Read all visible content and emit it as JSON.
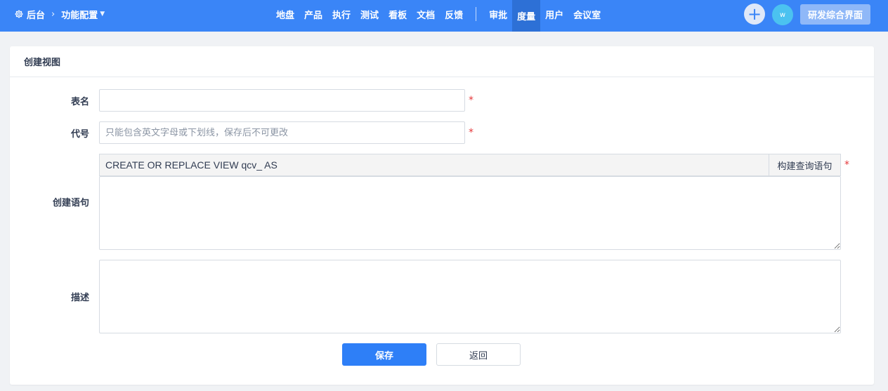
{
  "header": {
    "breadcrumb_root": "后台",
    "breadcrumb_separator": "›",
    "breadcrumb_current": "功能配置",
    "nav": [
      "地盘",
      "产品",
      "执行",
      "测试",
      "看板",
      "文档",
      "反馈"
    ],
    "nav_right": [
      "审批",
      "度量",
      "用户",
      "会议室"
    ],
    "active_nav": "度量",
    "plus_label": "+",
    "avatar_text": "w",
    "workspace_button": "研发综合界面"
  },
  "panel": {
    "title": "创建视图"
  },
  "form": {
    "table_name_label": "表名",
    "table_name_value": "",
    "code_label": "代号",
    "code_placeholder": "只能包含英文字母或下划线，保存后不可更改",
    "sql_label": "创建语句",
    "sql_prefix": "CREATE OR REPLACE VIEW qcv_ AS",
    "build_query_button": "构建查询语句",
    "description_label": "描述",
    "required_mark": "*"
  },
  "actions": {
    "save": "保存",
    "back": "返回"
  },
  "colors": {
    "topbar": "#3a85f7",
    "active_nav": "#2d70d6",
    "primary_button": "#2e7ff7",
    "required": "#e5383b"
  }
}
